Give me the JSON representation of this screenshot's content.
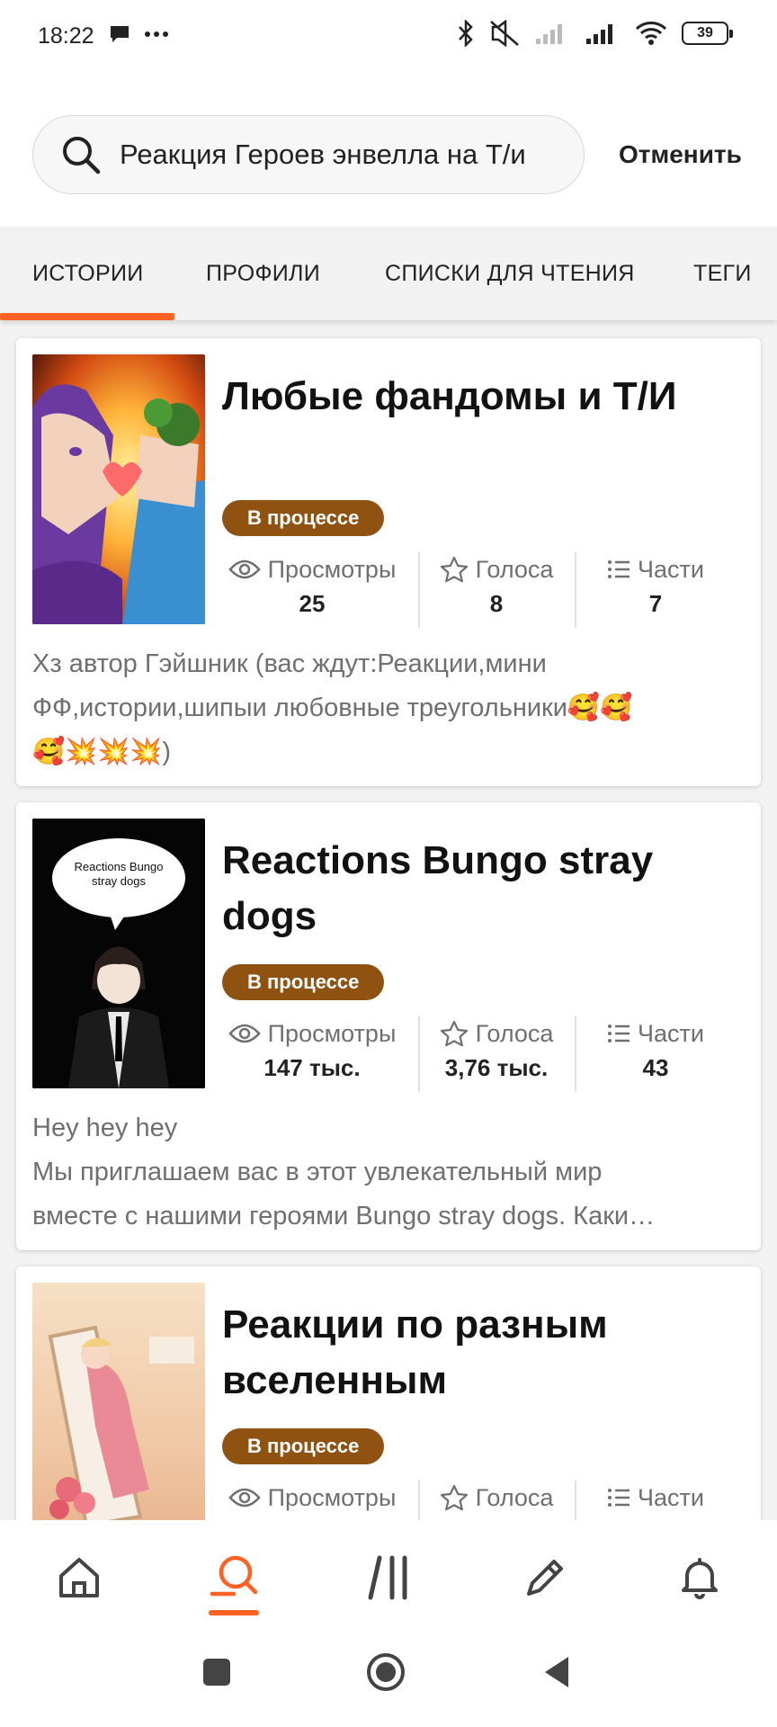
{
  "status_bar": {
    "time": "18:22",
    "battery": "39",
    "icons": [
      "chat-bubble-icon",
      "more-dots-icon",
      "bluetooth-icon",
      "mute-icon",
      "signal-icon",
      "signal-icon",
      "wifi-icon",
      "battery-icon"
    ]
  },
  "search": {
    "query": "Реакция Героев энвелла на Т/и",
    "cancel_label": "Отменить"
  },
  "tabs": [
    {
      "label": "ИСТОРИИ",
      "active": true
    },
    {
      "label": "ПРОФИЛИ",
      "active": false
    },
    {
      "label": "СПИСКИ ДЛЯ ЧТЕНИЯ",
      "active": false
    },
    {
      "label": "ТЕГИ",
      "active": false
    }
  ],
  "stories": [
    {
      "title": "Любые фандомы и Т/И",
      "status": "В процессе",
      "views_label": "Просмотры",
      "views": "25",
      "votes_label": "Голоса",
      "votes": "8",
      "parts_label": "Части",
      "parts": "7",
      "description_lines": [
        "Хз автор Гэйшник (вас ждут:Реакции,мини",
        "ФФ,истории,шипыи любовные треугольники🥰🥰",
        "🥰💥💥💥)"
      ]
    },
    {
      "title": "Reactions Bungo stray dogs",
      "cover_text": "Reactions Bungo stray dogs",
      "status": "В процессе",
      "views_label": "Просмотры",
      "views": "147 тыс.",
      "votes_label": "Голоса",
      "votes": "3,76 тыс.",
      "parts_label": "Части",
      "parts": "43",
      "description_lines": [
        "Hey hey hey",
        "Мы приглашаем вас в этот увлекательный мир",
        "вместе с нашими героями Bungo stray dogs. Каки…"
      ]
    },
    {
      "title": "Реакции по разным вселенным",
      "status": "В процессе",
      "views_label": "Просмотры",
      "votes_label": "Голоса",
      "parts_label": "Части"
    }
  ],
  "colors": {
    "accent": "#ff6122",
    "status_badge": "#8f5210"
  },
  "bottom_nav": [
    "home-icon",
    "search-icon",
    "library-icon",
    "write-icon",
    "notifications-icon"
  ],
  "system_nav": [
    "recents-button",
    "home-button",
    "back-button"
  ]
}
